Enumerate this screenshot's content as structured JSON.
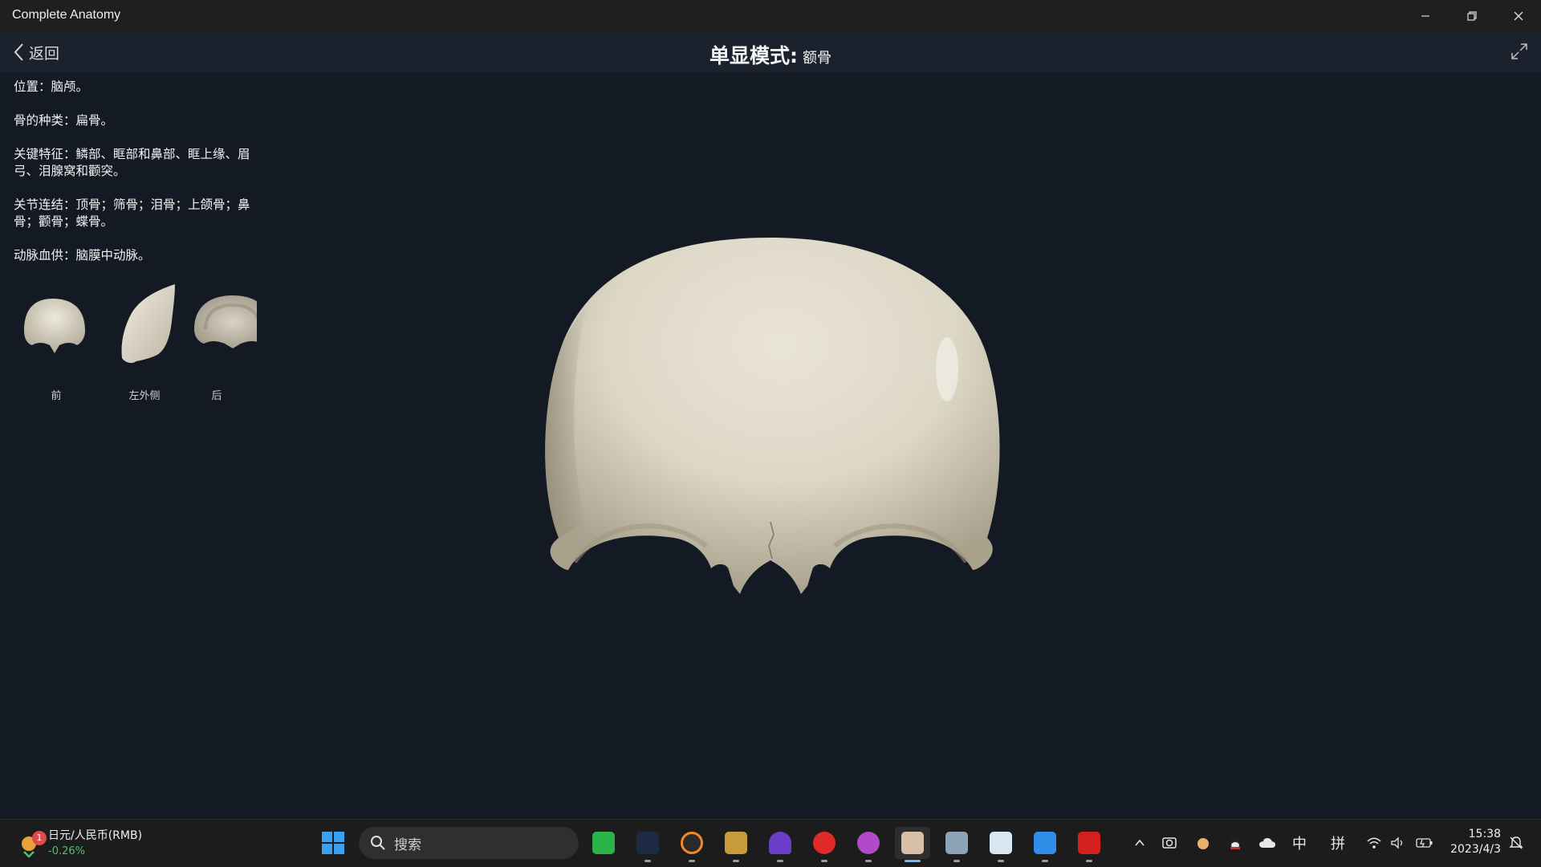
{
  "window": {
    "title": "Complete Anatomy"
  },
  "header": {
    "back_label": "返回",
    "mode_title": "单显模式:",
    "mode_subject": "额骨"
  },
  "info": [
    {
      "text": "位置：脑颅。"
    },
    {
      "text": "骨的种类：扁骨。"
    },
    {
      "text": "关键特征：鳞部、眶部和鼻部、眶上缘、眉弓、泪腺窝和颧突。"
    },
    {
      "text": "关节连结：顶骨；筛骨；泪骨；上颌骨；鼻骨；颧骨；蝶骨。"
    },
    {
      "text": "动脉血供：脑膜中动脉。"
    }
  ],
  "views": [
    {
      "label": "前"
    },
    {
      "label": "左外侧"
    },
    {
      "label": "后"
    }
  ],
  "taskbar": {
    "widget_title": "日元/人民币(RMB)",
    "widget_change": "-0.26%",
    "widget_badge": "1",
    "search_placeholder": "搜索",
    "tray_ime_1": "中",
    "tray_ime_2": "拼",
    "time": "15:38",
    "date": "2023/4/3"
  },
  "colors": {
    "viewer_bg": "#131a24",
    "header_bg": "#1b222d",
    "taskbar_bg": "#1c1c1c",
    "bone": "#ddd7c6"
  }
}
